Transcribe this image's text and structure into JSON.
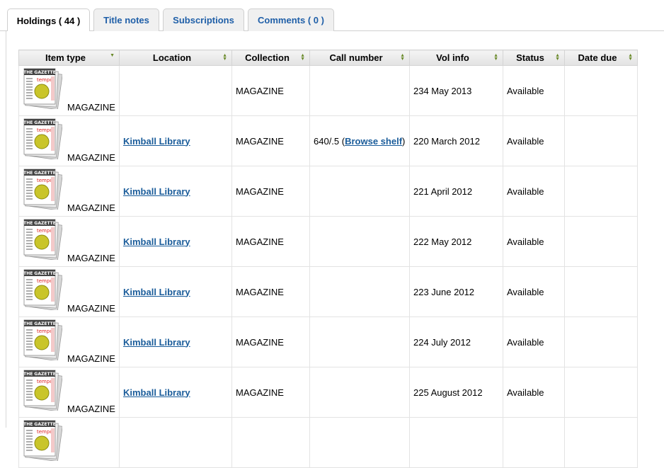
{
  "tabs": [
    {
      "label": "Holdings ( 44 )",
      "active": true
    },
    {
      "label": "Title notes",
      "active": false
    },
    {
      "label": "Subscriptions",
      "active": false
    },
    {
      "label": "Comments ( 0 )",
      "active": false
    }
  ],
  "table": {
    "headers": [
      "Item type",
      "Location",
      "Collection",
      "Call number",
      "Vol info",
      "Status",
      "Date due"
    ],
    "rows": [
      {
        "item_type": "MAGAZINE",
        "location": "",
        "collection": "MAGAZINE",
        "call_number": "",
        "browse": "",
        "vol_info": "234 May 2013",
        "status": "Available",
        "date_due": ""
      },
      {
        "item_type": "MAGAZINE",
        "location": "Kimball Library",
        "collection": "MAGAZINE",
        "call_number": "640/.5",
        "browse": "Browse shelf",
        "vol_info": "220 March 2012",
        "status": "Available",
        "date_due": ""
      },
      {
        "item_type": "MAGAZINE",
        "location": "Kimball Library",
        "collection": "MAGAZINE",
        "call_number": "",
        "browse": "",
        "vol_info": "221 April 2012",
        "status": "Available",
        "date_due": ""
      },
      {
        "item_type": "MAGAZINE",
        "location": "Kimball Library",
        "collection": "MAGAZINE",
        "call_number": "",
        "browse": "",
        "vol_info": "222 May 2012",
        "status": "Available",
        "date_due": ""
      },
      {
        "item_type": "MAGAZINE",
        "location": "Kimball Library",
        "collection": "MAGAZINE",
        "call_number": "",
        "browse": "",
        "vol_info": "223 June 2012",
        "status": "Available",
        "date_due": ""
      },
      {
        "item_type": "MAGAZINE",
        "location": "Kimball Library",
        "collection": "MAGAZINE",
        "call_number": "",
        "browse": "",
        "vol_info": "224 July 2012",
        "status": "Available",
        "date_due": ""
      },
      {
        "item_type": "MAGAZINE",
        "location": "Kimball Library",
        "collection": "MAGAZINE",
        "call_number": "",
        "browse": "",
        "vol_info": "225 August 2012",
        "status": "Available",
        "date_due": ""
      }
    ]
  },
  "icon": {
    "name": "magazine-icon",
    "masthead": "THE GAZETTE",
    "cover_word": "tempo"
  },
  "colors": {
    "link": "#1a5c9a",
    "tab_link": "#1f5fa8",
    "sort_arrow": "#6a8a2a"
  }
}
